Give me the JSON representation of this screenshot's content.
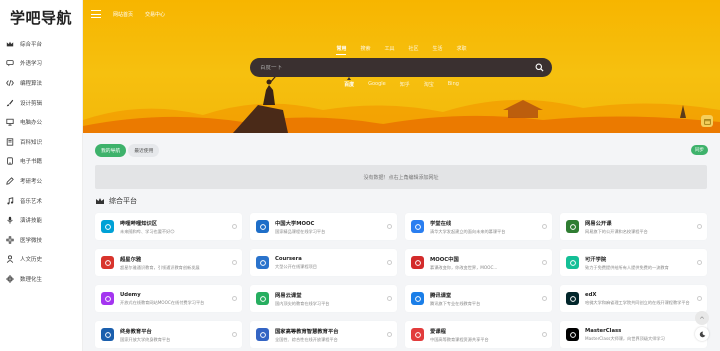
{
  "brand": {
    "name": "学吧导航"
  },
  "sidebar": {
    "items": [
      {
        "label": "综合平台",
        "icon": "crown-icon"
      },
      {
        "label": "外语学习",
        "icon": "chat-icon"
      },
      {
        "label": "编程算法",
        "icon": "code-icon"
      },
      {
        "label": "设计剪辑",
        "icon": "brush-icon"
      },
      {
        "label": "电脑办公",
        "icon": "monitor-icon"
      },
      {
        "label": "百科知识",
        "icon": "book-icon"
      },
      {
        "label": "电子书籍",
        "icon": "ebook-icon"
      },
      {
        "label": "考研考公",
        "icon": "pen-icon"
      },
      {
        "label": "音乐艺术",
        "icon": "music-icon"
      },
      {
        "label": "演讲技能",
        "icon": "mic-icon"
      },
      {
        "label": "医学微技",
        "icon": "medical-icon"
      },
      {
        "label": "人文历史",
        "icon": "person-icon"
      },
      {
        "label": "数理化生",
        "icon": "atom-icon"
      }
    ]
  },
  "header": {
    "links": [
      "网站首页",
      "交易中心"
    ]
  },
  "search": {
    "tabs": [
      "常用",
      "搜索",
      "工具",
      "社区",
      "生活",
      "求职"
    ],
    "active_tab": "常用",
    "placeholder": "百度一下",
    "engines": [
      "百度",
      "Google",
      "知乎",
      "淘宝",
      "Bing"
    ],
    "active_engine": "百度"
  },
  "main": {
    "pills": [
      "我的导航",
      "最近使用"
    ],
    "active_pill": "我的导航",
    "sync_label": "同步",
    "empty_text": "没有数据！点右上角编辑添加网址",
    "section_title": "综合平台"
  },
  "cards": [
    {
      "name": "哔哩哔哩知识区",
      "desc": "未来随和哔、学习也要不好😊",
      "color": "#00a1d6",
      "icon": "tv-icon"
    },
    {
      "name": "中国大学MOOC",
      "desc": "国家精品课程在线学习平台",
      "color": "#1e6ec8",
      "icon": "mooc-icon"
    },
    {
      "name": "学堂在线",
      "desc": "清华大学发起建立的面向未来的慕课平台",
      "color": "#2a7ef0",
      "icon": "xuetang-icon"
    },
    {
      "name": "网易公开课",
      "desc": "网易旗下的公开课和名校课程平台",
      "color": "#2f7d32",
      "icon": "netease-icon"
    },
    {
      "name": "超星尔雅",
      "desc": "超星尔雅通识教育，引领通识教育创新发展",
      "color": "#d8342c",
      "icon": "chaoxing-icon"
    },
    {
      "name": "Coursera",
      "desc": "大型公开在线课程项目",
      "color": "#2a73cc",
      "icon": "coursera-icon"
    },
    {
      "name": "MOOC中国",
      "desc": "慕课改变你，你改变世界，MOOC...",
      "color": "#d32b2b",
      "icon": "moocchina-icon"
    },
    {
      "name": "可汗学院",
      "desc": "致力于免费提供给所有人提供免费的一流教育",
      "color": "#14bf96",
      "icon": "khan-icon"
    },
    {
      "name": "Udemy",
      "desc": "开放式在线教育网站MOOC在线付费学习平台",
      "color": "#a435f0",
      "icon": "udemy-icon"
    },
    {
      "name": "网易云课堂",
      "desc": "国内顶尖的教育在线学习平台",
      "color": "#27ae60",
      "icon": "163study-icon"
    },
    {
      "name": "腾讯课堂",
      "desc": "腾讯旗下专业在线教育平台",
      "color": "#1a7ee8",
      "icon": "tencent-icon"
    },
    {
      "name": "edX",
      "desc": "哈佛大学和麻省理工学院共同创立的在线开课程教学平台",
      "color": "#02262b",
      "icon": "edx-icon"
    },
    {
      "name": "终身教育平台",
      "desc": "国家开放大学终身教育平台",
      "color": "#1b5fad",
      "icon": "lifelong-icon"
    },
    {
      "name": "国家高等教育智慧教育平台",
      "desc": "全国性、综合性在线开放课程平台",
      "color": "#3465c4",
      "icon": "smartedu-icon"
    },
    {
      "name": "爱课程",
      "desc": "中国高等教育课程资源共享平台",
      "color": "#e23c3c",
      "icon": "icourse-icon"
    },
    {
      "name": "MasterClass",
      "desc": "MasterClass大师课，向世界顶级大师学习",
      "color": "#000000",
      "icon": "masterclass-icon"
    }
  ]
}
